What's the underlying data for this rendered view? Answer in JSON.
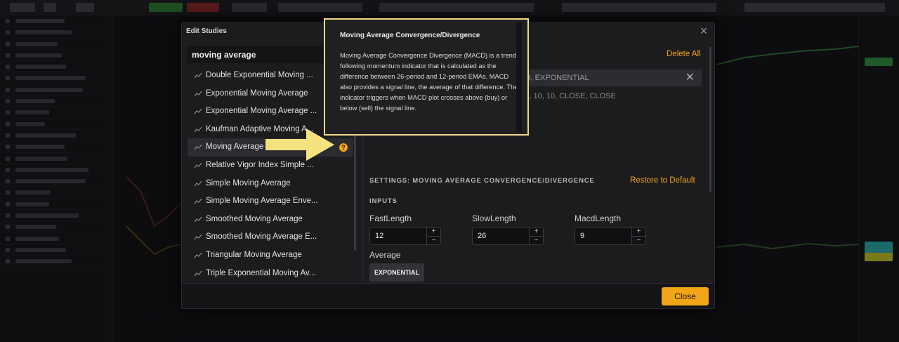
{
  "modal": {
    "title": "Edit Studies",
    "search_value": "moving average",
    "studies": [
      {
        "label": "Double Exponential Moving ..."
      },
      {
        "label": "Exponential Moving Average"
      },
      {
        "label": "Exponential Moving Average ..."
      },
      {
        "label": "Kaufman Adaptive Moving A..."
      },
      {
        "label": "Moving Average"
      },
      {
        "label": "Relative Vigor Index Simple ..."
      },
      {
        "label": "Simple Moving Average"
      },
      {
        "label": "Simple Moving Average Enve..."
      },
      {
        "label": "Smoothed Moving Average"
      },
      {
        "label": "Smoothed Moving Average E..."
      },
      {
        "label": "Triangular Moving Average"
      },
      {
        "label": "Triple Exponential Moving Av..."
      }
    ],
    "delete_all": "Delete All",
    "added_study_1": "26, 9, EXPONENTIAL",
    "added_study_2": "0, 0, 10, 10, CLOSE, CLOSE",
    "settings_title": "SETTINGS: MOVING AVERAGE CONVERGENCE/DIVERGENCE",
    "restore_default": "Restore to Default",
    "inputs_title": "INPUTS",
    "inputs": [
      {
        "label": "FastLength",
        "value": "12"
      },
      {
        "label": "SlowLength",
        "value": "26"
      },
      {
        "label": "MacdLength",
        "value": "9"
      }
    ],
    "average_label": "Average",
    "average_value": "EXPONENTIAL",
    "close_label": "Close"
  },
  "tooltip": {
    "title": "Moving Average Convergence/Divergence",
    "body": "Moving Average Convergence Divergence (MACD) is a trend-following momentum indicator that is calculated as the difference between 26-period and 12-period EMAs. MACD also provides a signal line, the average of that difference. The indicator triggers when MACD plot crosses above (buy) or below (sell) the signal line."
  },
  "icons": {
    "close": "close-icon",
    "help": "help-icon",
    "study": "study-wave-icon",
    "remove": "remove-x-icon",
    "arrow": "pointer-arrow"
  },
  "colors": {
    "accent": "#f2a516",
    "highlight_frame": "#f0d98a",
    "arrow": "#f5e27e",
    "modal_bg": "#1c1c1f"
  }
}
